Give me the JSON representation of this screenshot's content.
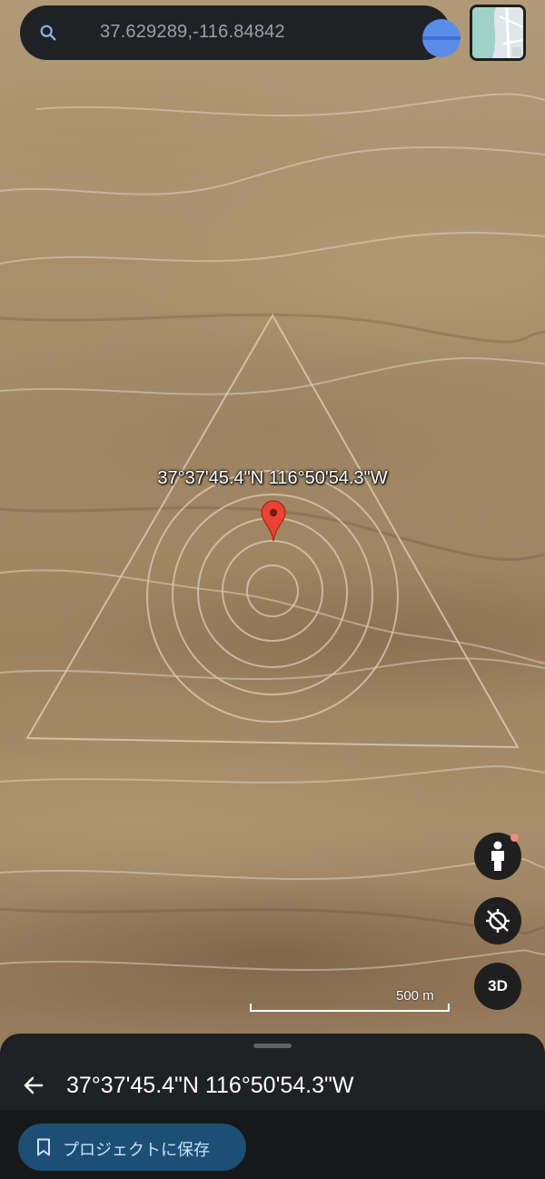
{
  "search": {
    "value": "37.629289,-116.84842",
    "icon": "search-icon"
  },
  "map": {
    "marker_label": "37°37'45.4\"N 116°50'54.3\"W",
    "scale_label": "500 m",
    "controls": {
      "pegman_icon": "pegman-icon",
      "orientation_icon": "location-disabled-icon",
      "three_d_label": "3D"
    }
  },
  "bottom_sheet": {
    "title": "37°37'45.4\"N 116°50'54.3\"W",
    "save_button_label": "プロジェクトに保存"
  },
  "colors": {
    "accent_blue": "#5b8de8",
    "pin_red": "#ea4335",
    "sheet_bg": "#202124",
    "save_button_bg": "#1c4f73"
  }
}
